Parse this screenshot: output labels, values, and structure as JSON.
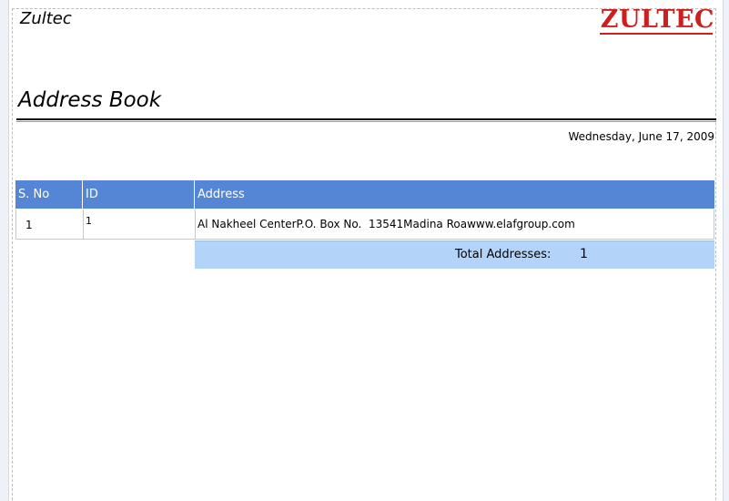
{
  "header": {
    "company_name": "Zultec",
    "logo_text": "ZULTEC"
  },
  "report": {
    "title": "Address Book",
    "date": "Wednesday, June 17, 2009"
  },
  "table": {
    "columns": [
      "S. No",
      "ID",
      "Address"
    ],
    "rows": [
      {
        "sno": "1",
        "id": "1",
        "address": "Al Nakheel CenterP.O. Box No.  13541Madina Roawww.elafgroup.com"
      }
    ]
  },
  "footer": {
    "total_label": "Total Addresses:",
    "total_value": "1"
  },
  "colors": {
    "header_bg": "#5585d5",
    "total_bg": "#b3d4f8",
    "logo": "#cc1f1f"
  }
}
